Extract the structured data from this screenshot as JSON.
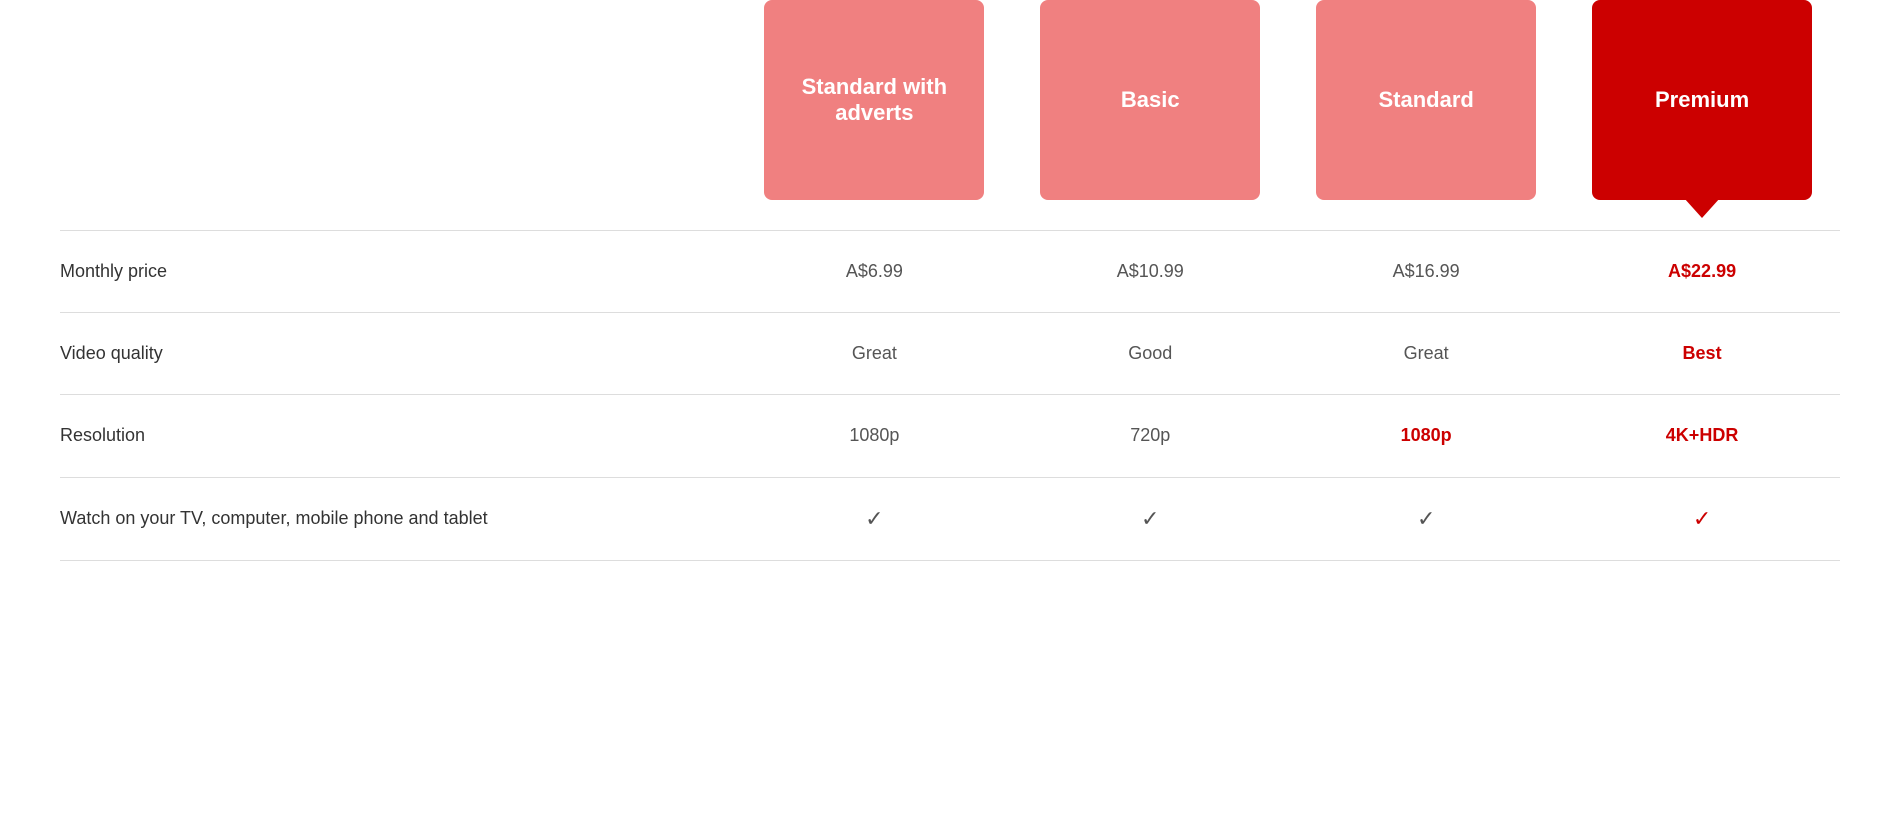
{
  "plans": [
    {
      "id": "standard-adverts",
      "label": "Standard with adverts",
      "colorClass": "standard-adverts",
      "price": "A$6.99",
      "isPremium": false,
      "videoQuality": "Great",
      "resolution": "1080p",
      "watchDevices": true,
      "videoQualityHighlight": false,
      "resolutionHighlight": false
    },
    {
      "id": "basic",
      "label": "Basic",
      "colorClass": "basic",
      "price": "A$10.99",
      "isPremium": false,
      "videoQuality": "Good",
      "resolution": "720p",
      "watchDevices": true,
      "videoQualityHighlight": false,
      "resolutionHighlight": false
    },
    {
      "id": "standard",
      "label": "Standard",
      "colorClass": "standard",
      "price": "A$16.99",
      "isPremium": false,
      "videoQuality": "Great",
      "resolution": "1080p",
      "watchDevices": true,
      "videoQualityHighlight": false,
      "resolutionHighlight": true
    },
    {
      "id": "premium",
      "label": "Premium",
      "colorClass": "premium",
      "price": "A$22.99",
      "isPremium": true,
      "videoQuality": "Best",
      "resolution": "4K+HDR",
      "watchDevices": true,
      "videoQualityHighlight": true,
      "resolutionHighlight": true
    }
  ],
  "rows": [
    {
      "id": "monthly-price",
      "label": "Monthly price"
    },
    {
      "id": "video-quality",
      "label": "Video quality"
    },
    {
      "id": "resolution",
      "label": "Resolution"
    },
    {
      "id": "watch-devices",
      "label": "Watch on your TV, computer, mobile phone and tablet"
    }
  ]
}
